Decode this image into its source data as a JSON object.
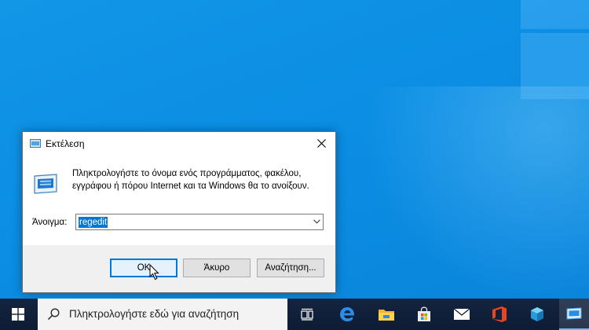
{
  "dialog": {
    "title": "Εκτέλεση",
    "description": "Πληκτρολογήστε το όνομα ενός προγράμματος, φακέλου, εγγράφου ή πόρου Internet και τα Windows θα το ανοίξουν.",
    "open_label": "Άνοιγμα:",
    "open_value": "regedit",
    "ok_label": "OK",
    "cancel_label": "Άκυρο",
    "browse_label": "Αναζήτηση..."
  },
  "taskbar": {
    "search_placeholder": "Πληκτρολογήστε εδώ για αναζήτηση",
    "pinned": [
      "start-icon",
      "task-view-icon",
      "edge-icon",
      "file-explorer-icon",
      "store-icon",
      "mail-icon",
      "office-icon",
      "people-icon",
      "run-icon"
    ]
  },
  "colors": {
    "desktop": "#0b8ee4",
    "accent": "#0078d7",
    "taskbar": "#14243f",
    "office": "#d83b01"
  }
}
